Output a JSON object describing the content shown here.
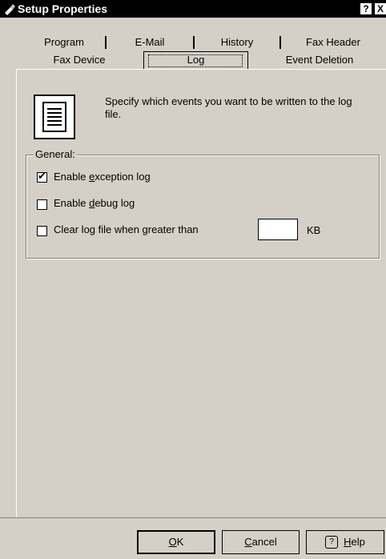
{
  "window": {
    "title": "Setup Properties",
    "help_button": "?",
    "close_button": "X"
  },
  "tabs": {
    "row1": [
      "Program",
      "E-Mail",
      "History",
      "Fax Header"
    ],
    "row2": [
      "Fax Device",
      "Log",
      "Event Deletion"
    ],
    "active": "Log"
  },
  "description": "Specify which events you want to be written to the log file.",
  "general": {
    "label": "General:",
    "options": [
      {
        "pre": "Enable ",
        "accel": "e",
        "post": "xception log",
        "checked": true
      },
      {
        "pre": "Enable ",
        "accel": "d",
        "post": "ebug log",
        "checked": false
      },
      {
        "pre": "Clear log file when greater than",
        "accel": "",
        "post": "",
        "checked": false
      }
    ],
    "size_value": "",
    "size_unit": "KB"
  },
  "buttons": {
    "ok": {
      "accel": "O",
      "rest": "K"
    },
    "cancel": {
      "accel": "C",
      "rest": "ancel"
    },
    "help": {
      "accel": "H",
      "rest": "elp"
    }
  }
}
